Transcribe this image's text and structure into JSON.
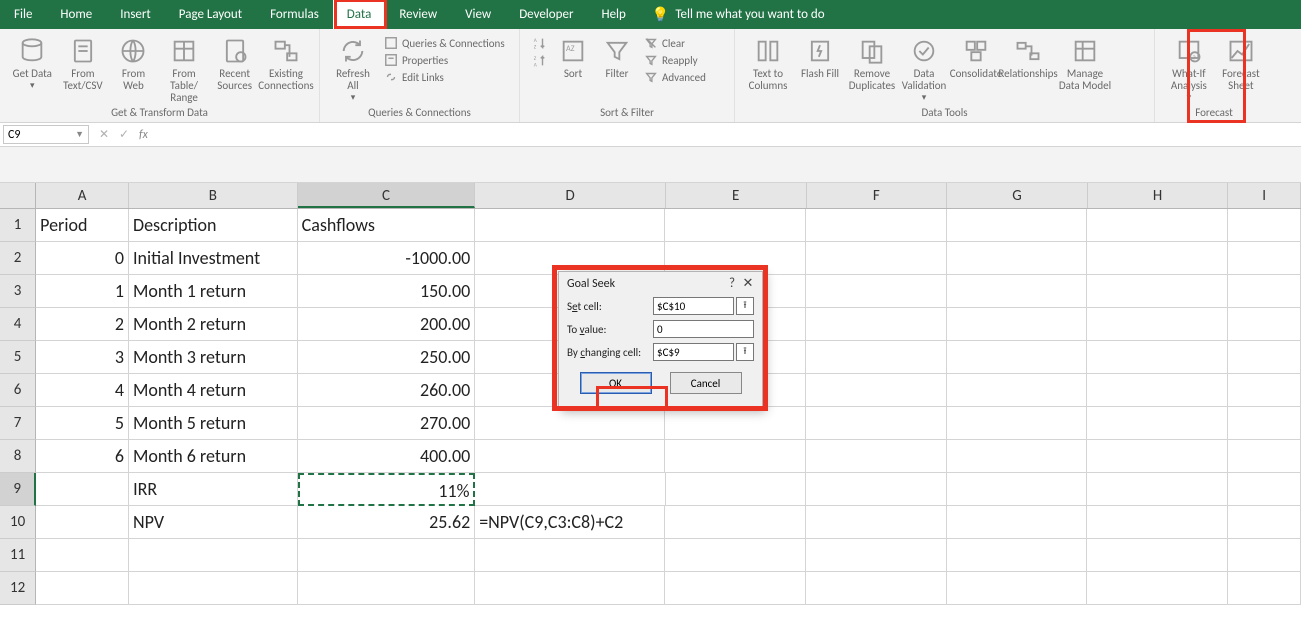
{
  "menubar": {
    "tabs": [
      "File",
      "Home",
      "Insert",
      "Page Layout",
      "Formulas",
      "Data",
      "Review",
      "View",
      "Developer",
      "Help"
    ],
    "active_index": 5,
    "tellme": "Tell me what you want to do"
  },
  "ribbon": {
    "groups": [
      {
        "label": "Get & Transform Data",
        "buttons": [
          "Get Data",
          "From Text/CSV",
          "From Web",
          "From Table/ Range",
          "Recent Sources",
          "Existing Connections"
        ]
      },
      {
        "label": "Queries & Connections",
        "big": "Refresh All",
        "small": [
          "Queries & Connections",
          "Properties",
          "Edit Links"
        ]
      },
      {
        "label": "Sort & Filter",
        "buttons": [
          "Sort",
          "Filter"
        ],
        "small": [
          "Clear",
          "Reapply",
          "Advanced"
        ],
        "az": "AZ"
      },
      {
        "label": "Data Tools",
        "buttons": [
          "Text to Columns",
          "Flash Fill",
          "Remove Duplicates",
          "Data Validation",
          "Consolidate",
          "Relationships",
          "Manage Data Model"
        ]
      },
      {
        "label": "Forecast",
        "buttons": [
          "What-If Analysis",
          "Forecast Sheet"
        ]
      }
    ]
  },
  "formula_bar": {
    "name_box": "C9",
    "fx": "fx",
    "formula": ""
  },
  "columns": [
    "A",
    "B",
    "C",
    "D",
    "E",
    "F",
    "G",
    "H",
    "I"
  ],
  "rows": [
    {
      "n": 1,
      "A": "Period",
      "B": "Description",
      "C": "Cashflows",
      "D": ""
    },
    {
      "n": 2,
      "A": "0",
      "B": "Initial Investment",
      "C": "-1000.00",
      "D": ""
    },
    {
      "n": 3,
      "A": "1",
      "B": "Month 1 return",
      "C": "150.00",
      "D": ""
    },
    {
      "n": 4,
      "A": "2",
      "B": "Month 2 return",
      "C": "200.00",
      "D": ""
    },
    {
      "n": 5,
      "A": "3",
      "B": "Month 3 return",
      "C": "250.00",
      "D": ""
    },
    {
      "n": 6,
      "A": "4",
      "B": "Month 4 return",
      "C": "260.00",
      "D": ""
    },
    {
      "n": 7,
      "A": "5",
      "B": "Month 5 return",
      "C": "270.00",
      "D": ""
    },
    {
      "n": 8,
      "A": "6",
      "B": "Month 6 return",
      "C": "400.00",
      "D": ""
    },
    {
      "n": 9,
      "A": "",
      "B": "IRR",
      "C": "11%",
      "D": ""
    },
    {
      "n": 10,
      "A": "",
      "B": "NPV",
      "C": "25.62",
      "D": "=NPV(C9,C3:C8)+C2"
    },
    {
      "n": 11,
      "A": "",
      "B": "",
      "C": "",
      "D": ""
    },
    {
      "n": 12,
      "A": "",
      "B": "",
      "C": "",
      "D": ""
    }
  ],
  "dialog": {
    "title": "Goal Seek",
    "set_cell_label": "Set cell:",
    "set_cell_value": "$C$10",
    "to_value_label": "To value:",
    "to_value_value": "0",
    "by_changing_label": "By changing cell:",
    "by_changing_value": "$C$9",
    "ok": "OK",
    "cancel": "Cancel"
  },
  "chart_data": {
    "type": "table",
    "title": "Cashflows",
    "columns": [
      "Period",
      "Description",
      "Cashflows"
    ],
    "rows": [
      [
        0,
        "Initial Investment",
        -1000.0
      ],
      [
        1,
        "Month 1 return",
        150.0
      ],
      [
        2,
        "Month 2 return",
        200.0
      ],
      [
        3,
        "Month 3 return",
        250.0
      ],
      [
        4,
        "Month 4 return",
        260.0
      ],
      [
        5,
        "Month 5 return",
        270.0
      ],
      [
        6,
        "Month 6 return",
        400.0
      ]
    ],
    "summary": {
      "IRR": "11%",
      "NPV": 25.62,
      "NPV_formula": "=NPV(C9,C3:C8)+C2"
    }
  }
}
